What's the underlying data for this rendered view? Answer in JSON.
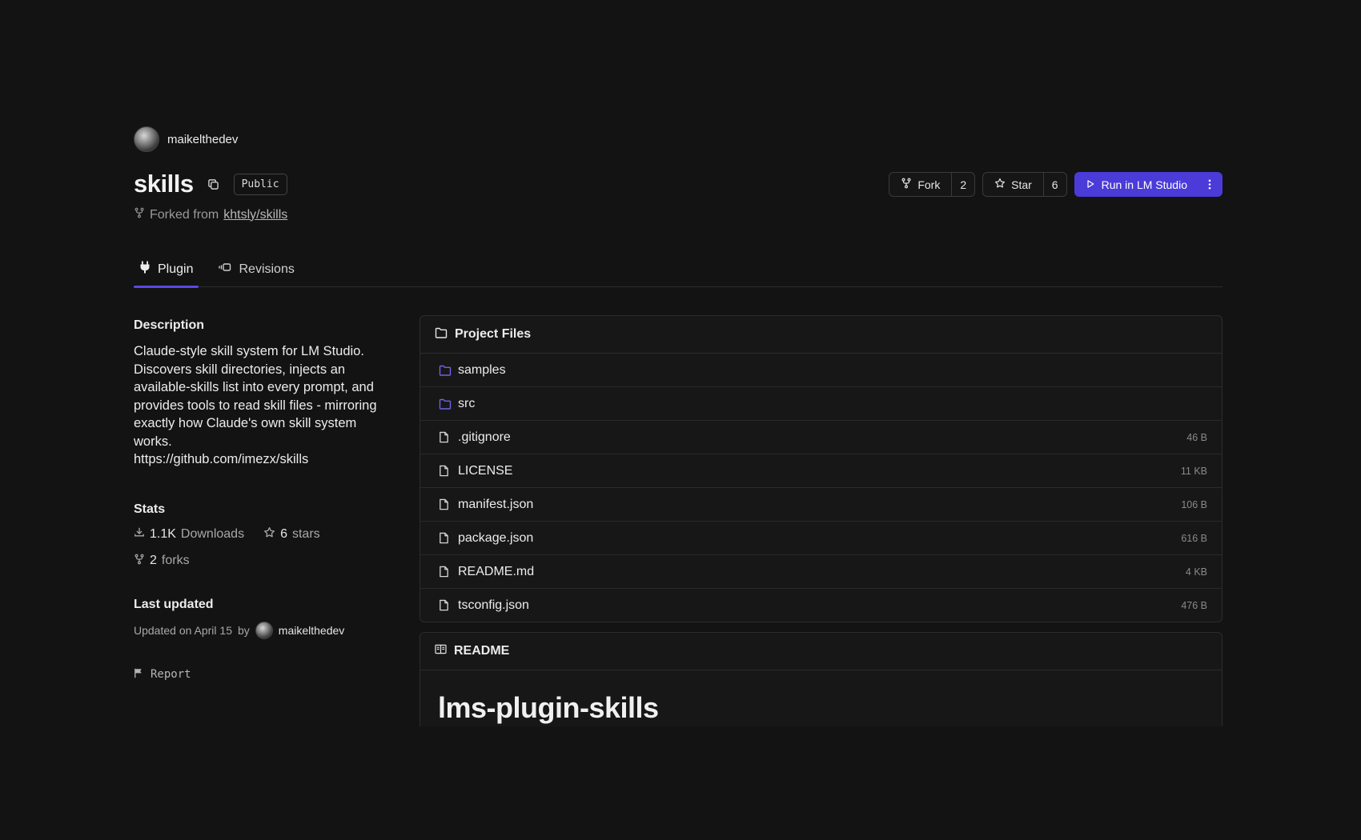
{
  "repo": {
    "owner": "maikelthedev",
    "name": "skills",
    "visibility": "Public",
    "forked_from_label": "Forked from",
    "forked_from": "khtsly/skills"
  },
  "actions": {
    "fork_label": "Fork",
    "fork_count": "2",
    "star_label": "Star",
    "star_count": "6",
    "run_label": "Run in LM Studio"
  },
  "tabs": [
    {
      "label": "Plugin",
      "active": true
    },
    {
      "label": "Revisions",
      "active": false
    }
  ],
  "sidebar": {
    "description_heading": "Description",
    "description": "Claude-style skill system for LM Studio. Discovers skill directories, injects an available-skills list into every prompt, and provides tools to read skill files - mirroring exactly how Claude's own skill system works.",
    "description_link": "https://github.com/imezx/skills",
    "stats_heading": "Stats",
    "downloads_value": "1.1K",
    "downloads_label": "Downloads",
    "stars_value": "6",
    "stars_label": "stars",
    "forks_value": "2",
    "forks_label": "forks",
    "last_updated_heading": "Last updated",
    "updated_text": "Updated on April 15",
    "updated_by": "by",
    "updated_user": "maikelthedev",
    "report_label": "Report"
  },
  "project_files": {
    "heading": "Project Files",
    "items": [
      {
        "name": "samples",
        "type": "folder",
        "size": ""
      },
      {
        "name": "src",
        "type": "folder",
        "size": ""
      },
      {
        "name": ".gitignore",
        "type": "file",
        "size": "46 B"
      },
      {
        "name": "LICENSE",
        "type": "file",
        "size": "11 KB"
      },
      {
        "name": "manifest.json",
        "type": "file",
        "size": "106 B"
      },
      {
        "name": "package.json",
        "type": "file",
        "size": "616 B"
      },
      {
        "name": "README.md",
        "type": "file",
        "size": "4 KB"
      },
      {
        "name": "tsconfig.json",
        "type": "file",
        "size": "476 B"
      }
    ]
  },
  "readme": {
    "heading": "README",
    "title": "lms-plugin-skills"
  },
  "colors": {
    "background": "#131313",
    "accent": "#4b3bd8",
    "tab_underline": "#5a4ae6",
    "folder_icon": "#6f63e8"
  }
}
